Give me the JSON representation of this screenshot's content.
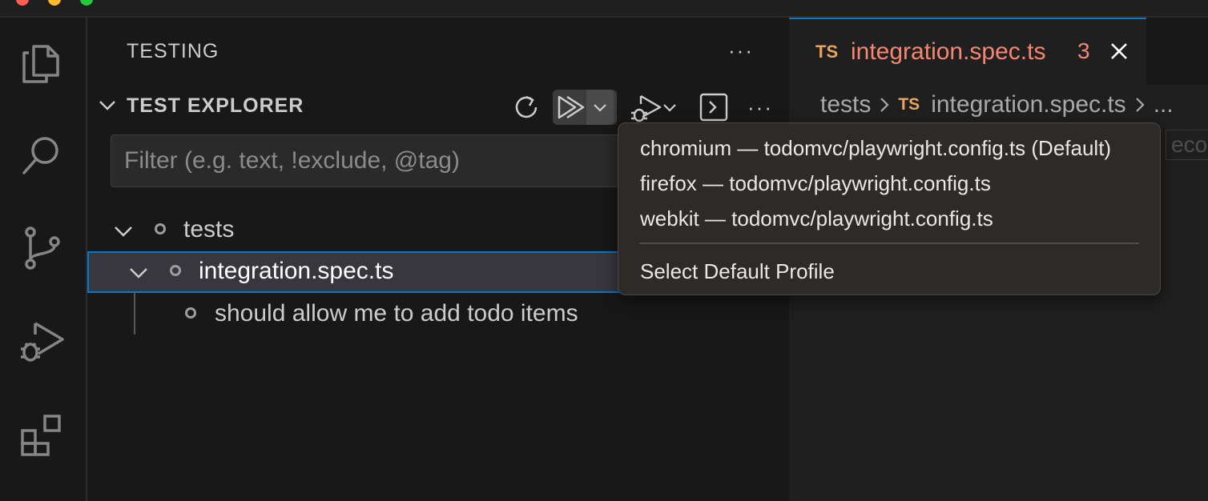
{
  "sidebar": {
    "title": "TESTING",
    "more_label": "···",
    "section_title": "TEST EXPLORER",
    "filter": {
      "placeholder": "Filter (e.g. text, !exclude, @tag)",
      "value": ""
    },
    "tree": [
      {
        "label": "tests",
        "expanded": true
      },
      {
        "label": "integration.spec.ts",
        "expanded": true,
        "selected": true
      },
      {
        "label": "should allow me to add todo items"
      }
    ],
    "toolbar_icons": [
      "refresh-icon",
      "run-tests-icon",
      "chevron-down-icon",
      "debug-tests-icon",
      "chevron-down-icon",
      "terminal-icon",
      "more-icon"
    ]
  },
  "activity_bar": {
    "icons": [
      "explorer-icon",
      "search-icon",
      "source-control-icon",
      "run-debug-icon",
      "extensions-icon"
    ]
  },
  "editor": {
    "tab": {
      "lang_badge": "TS",
      "name": "integration.spec.ts",
      "problem_count": "3"
    },
    "breadcrumb": [
      "tests",
      "integration.spec.ts",
      "..."
    ],
    "code_peek": "ecor"
  },
  "profile_menu": {
    "items": [
      "chromium — todomvc/playwright.config.ts (Default)",
      "firefox — todomvc/playwright.config.ts",
      "webkit — todomvc/playwright.config.ts"
    ],
    "footer_item": "Select Default Profile"
  },
  "colors": {
    "accent": "#0078d4",
    "error": "#f48771",
    "ts_badge": "#e7a560",
    "background": "#181818"
  }
}
